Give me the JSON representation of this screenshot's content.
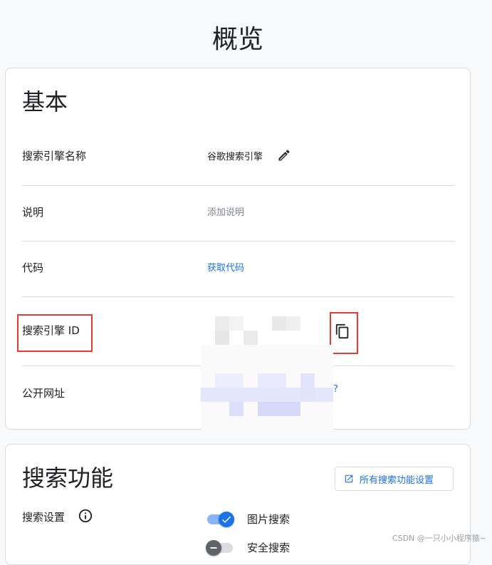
{
  "page": {
    "title": "概览"
  },
  "basic": {
    "title": "基本",
    "rows": [
      {
        "label": "搜索引擎名称",
        "value": "谷歌搜索引擎"
      },
      {
        "label": "说明",
        "value": "添加说明"
      },
      {
        "label": "代码",
        "value": "获取代码"
      },
      {
        "label": "搜索引擎 ID",
        "value": ""
      },
      {
        "label": "公开网址",
        "value": "?"
      }
    ],
    "icons": {
      "edit": "pencil-icon",
      "copy": "copy-icon"
    }
  },
  "search": {
    "title": "搜索功能",
    "all_settings_label": "所有搜索功能设置",
    "settings_label": "搜索设置",
    "toggles": [
      {
        "label": "图片搜索",
        "on": true
      },
      {
        "label": "安全搜索",
        "on": false
      }
    ]
  },
  "watermark": "CSDN @一只小小程序猿~",
  "colors": {
    "accent": "#1a73e8",
    "highlight": "#e53935",
    "toggle_on_track": "#8ab4f8",
    "toggle_off_track": "#dadce0"
  }
}
